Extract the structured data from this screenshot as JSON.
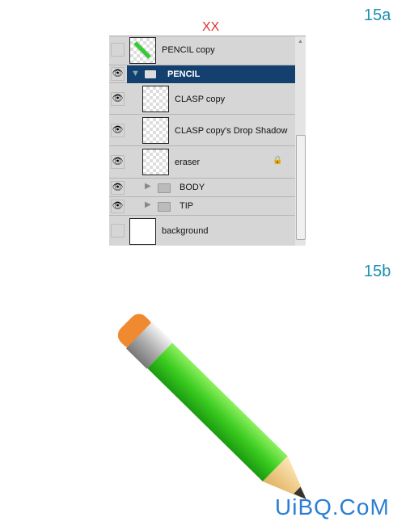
{
  "labels": {
    "a": "15a",
    "b": "15b",
    "xx": "XX"
  },
  "layers": [
    {
      "name": "PENCIL copy",
      "visible": false,
      "type": "layer"
    },
    {
      "name": "PENCIL",
      "visible": true,
      "type": "group",
      "expanded": true,
      "selected": true
    },
    {
      "name": "CLASP copy",
      "visible": true,
      "type": "layer"
    },
    {
      "name": "CLASP copy's Drop Shadow",
      "visible": true,
      "type": "layer"
    },
    {
      "name": "eraser",
      "visible": true,
      "type": "layer",
      "locked": true
    },
    {
      "name": "BODY",
      "visible": true,
      "type": "group",
      "expanded": false
    },
    {
      "name": "TIP",
      "visible": true,
      "type": "group",
      "expanded": false
    },
    {
      "name": "background",
      "visible": false,
      "type": "layer"
    }
  ],
  "watermark": "UiBQ.CoM",
  "colors": {
    "selected": "#13406e",
    "label": "#1a8fb0",
    "xx": "#e03030"
  }
}
